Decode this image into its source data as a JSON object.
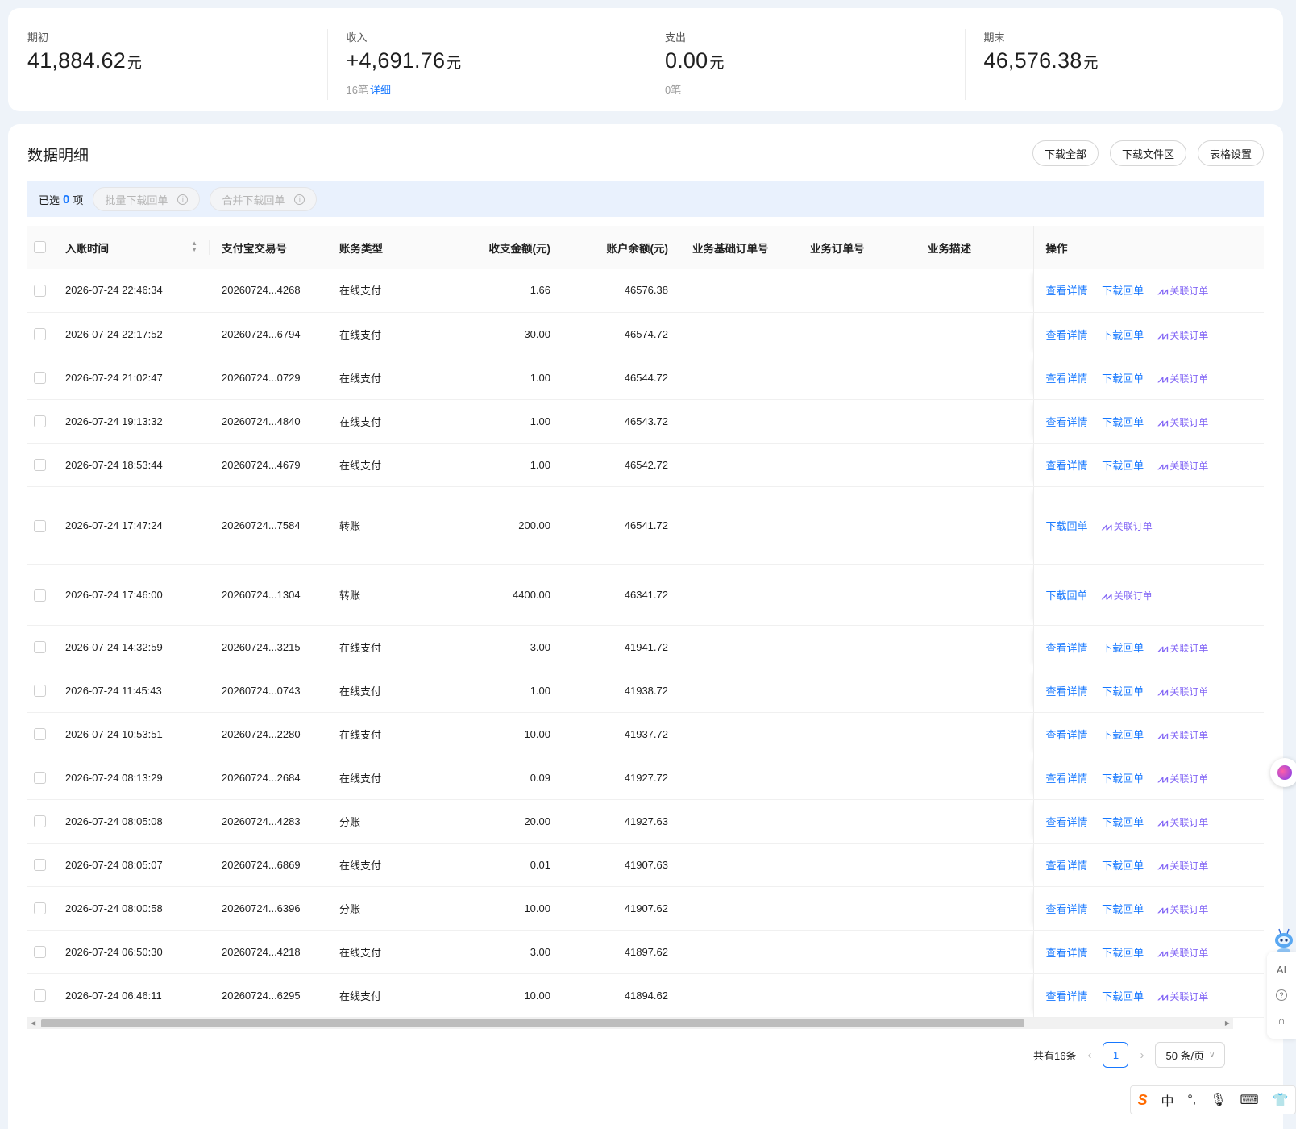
{
  "summary": [
    {
      "label": "期初",
      "value": "41,884.62",
      "unit": "元",
      "sub": "",
      "link": ""
    },
    {
      "label": "收入",
      "value": "+4,691.76",
      "unit": "元",
      "sub": "16笔",
      "link": "详细"
    },
    {
      "label": "支出",
      "value": "0.00",
      "unit": "元",
      "sub": "0笔",
      "link": ""
    },
    {
      "label": "期末",
      "value": "46,576.38",
      "unit": "元",
      "sub": "",
      "link": ""
    }
  ],
  "detail": {
    "title": "数据明细",
    "buttons": [
      "下载全部",
      "下载文件区",
      "表格设置"
    ],
    "selected_prefix": "已选",
    "selected_count": "0",
    "selected_suffix": "项",
    "batch_download": "批量下载回单",
    "merge_download": "合并下载回单"
  },
  "table": {
    "columns": [
      "入账时间",
      "支付宝交易号",
      "账务类型",
      "收支金额(元)",
      "账户余额(元)",
      "业务基础订单号",
      "业务订单号",
      "业务描述",
      "操作"
    ],
    "op_labels": {
      "view": "查看详情",
      "download": "下载回单",
      "link": "关联订单"
    },
    "rows": [
      {
        "time": "2026-07-24 22:46:34",
        "txn": "20260724...4268",
        "type": "在线支付",
        "amount": "1.66",
        "balance": "46576.38",
        "view": true
      },
      {
        "time": "2026-07-24 22:17:52",
        "txn": "20260724...6794",
        "type": "在线支付",
        "amount": "30.00",
        "balance": "46574.72",
        "view": true
      },
      {
        "time": "2026-07-24 21:02:47",
        "txn": "20260724...0729",
        "type": "在线支付",
        "amount": "1.00",
        "balance": "46544.72",
        "view": true
      },
      {
        "time": "2026-07-24 19:13:32",
        "txn": "20260724...4840",
        "type": "在线支付",
        "amount": "1.00",
        "balance": "46543.72",
        "view": true
      },
      {
        "time": "2026-07-24 18:53:44",
        "txn": "20260724...4679",
        "type": "在线支付",
        "amount": "1.00",
        "balance": "46542.72",
        "view": true
      },
      {
        "time": "2026-07-24 17:47:24",
        "txn": "20260724...7584",
        "type": "转账",
        "amount": "200.00",
        "balance": "46541.72",
        "view": false
      },
      {
        "time": "2026-07-24 17:46:00",
        "txn": "20260724...1304",
        "type": "转账",
        "amount": "4400.00",
        "balance": "46341.72",
        "view": false
      },
      {
        "time": "2026-07-24 14:32:59",
        "txn": "20260724...3215",
        "type": "在线支付",
        "amount": "3.00",
        "balance": "41941.72",
        "view": true
      },
      {
        "time": "2026-07-24 11:45:43",
        "txn": "20260724...0743",
        "type": "在线支付",
        "amount": "1.00",
        "balance": "41938.72",
        "view": true
      },
      {
        "time": "2026-07-24 10:53:51",
        "txn": "20260724...2280",
        "type": "在线支付",
        "amount": "10.00",
        "balance": "41937.72",
        "view": true
      },
      {
        "time": "2026-07-24 08:13:29",
        "txn": "20260724...2684",
        "type": "在线支付",
        "amount": "0.09",
        "balance": "41927.72",
        "view": true
      },
      {
        "time": "2026-07-24 08:05:08",
        "txn": "20260724...4283",
        "type": "分账",
        "amount": "20.00",
        "balance": "41927.63",
        "view": true
      },
      {
        "time": "2026-07-24 08:05:07",
        "txn": "20260724...6869",
        "type": "在线支付",
        "amount": "0.01",
        "balance": "41907.63",
        "view": true
      },
      {
        "time": "2026-07-24 08:00:58",
        "txn": "20260724...6396",
        "type": "分账",
        "amount": "10.00",
        "balance": "41907.62",
        "view": true
      },
      {
        "time": "2026-07-24 06:50:30",
        "txn": "20260724...4218",
        "type": "在线支付",
        "amount": "3.00",
        "balance": "41897.62",
        "view": true
      },
      {
        "time": "2026-07-24 06:46:11",
        "txn": "20260724...6295",
        "type": "在线支付",
        "amount": "10.00",
        "balance": "41894.62",
        "view": true
      }
    ]
  },
  "pagination": {
    "total": "共有16条",
    "current": "1",
    "page_size": "50 条/页"
  },
  "widgets": {
    "ai_label": "AI",
    "ime_chinese": "中"
  }
}
